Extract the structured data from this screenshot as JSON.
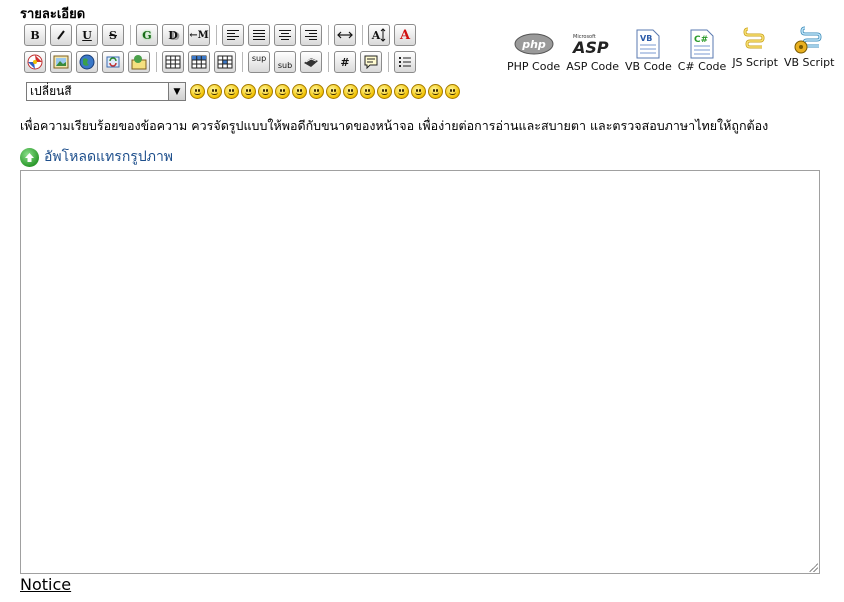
{
  "header": {
    "title": "รายละเอียด"
  },
  "toolbar": {
    "bold_label": "B",
    "underline_label": "U",
    "strike_label": "S",
    "glow_label": "G",
    "shadow_label": "D",
    "marquee_label": "←M",
    "fontsize_label": "A",
    "color_label": "A",
    "sup_label": "sup",
    "sub_label": "sub",
    "hash_label": "#"
  },
  "code_buttons": [
    {
      "label": "PHP Code",
      "icon": "php-icon"
    },
    {
      "label": "ASP Code",
      "icon": "asp-icon"
    },
    {
      "label": "VB Code",
      "icon": "vb-icon"
    },
    {
      "label": "C# Code",
      "icon": "csharp-icon"
    },
    {
      "label": "JS Script",
      "icon": "js-script-icon"
    },
    {
      "label": "VB Script",
      "icon": "vb-script-icon"
    }
  ],
  "code_icon_text": {
    "php": "php",
    "asp_small": "Microsoft",
    "asp": "ASP",
    "vb": "VB",
    "csharp": "C#"
  },
  "color_select": {
    "value": "เปลี่ยนสี"
  },
  "smileys_count": 16,
  "hint_text": "เพื่อความเรียบร้อยของข้อความ ควรจัดรูปแบบให้พอดีกับขนาดของหน้าจอ เพื่อง่ายต่อการอ่านและสบายตา และตรวจสอบภาษาไทยให้ถูกต้อง",
  "upload_link": "อัพโหลดแทรกรูปภาพ",
  "editor": {
    "value": ""
  },
  "notice_link": "Notice",
  "colors": {
    "link": "#1e4f8c",
    "accent_red": "#d01010"
  }
}
